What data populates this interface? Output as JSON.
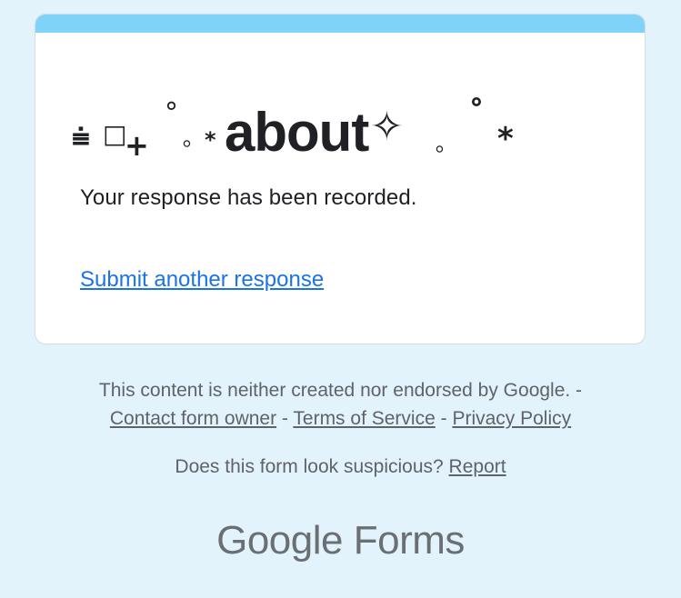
{
  "card": {
    "accent_color": "#7fd3f8",
    "title": {
      "prefix_symbol_1": "⩧",
      "prefix_symbol_2": "□",
      "prefix_symbol_3": "+",
      "deco_1": "°",
      "deco_2": "｡",
      "deco_3": "*",
      "word": "about",
      "sparkle": "✧",
      "deco_4": "｡",
      "deco_5": "˚",
      "deco_6": "*",
      "full_text": "⩧□+ ˚｡*about✧ ｡˚ *"
    },
    "confirmation": "Your response has been recorded.",
    "submit_another": "Submit another response"
  },
  "footer": {
    "disclaimer": "This content is neither created nor endorsed by Google. -",
    "contact": "Contact form owner",
    "sep1": " - ",
    "terms": "Terms of Service",
    "sep2": " - ",
    "privacy": "Privacy Policy"
  },
  "suspicious": {
    "question": "Does this form look suspicious?",
    "report": "Report"
  },
  "brand": {
    "google": "Google",
    "forms": "Forms"
  }
}
